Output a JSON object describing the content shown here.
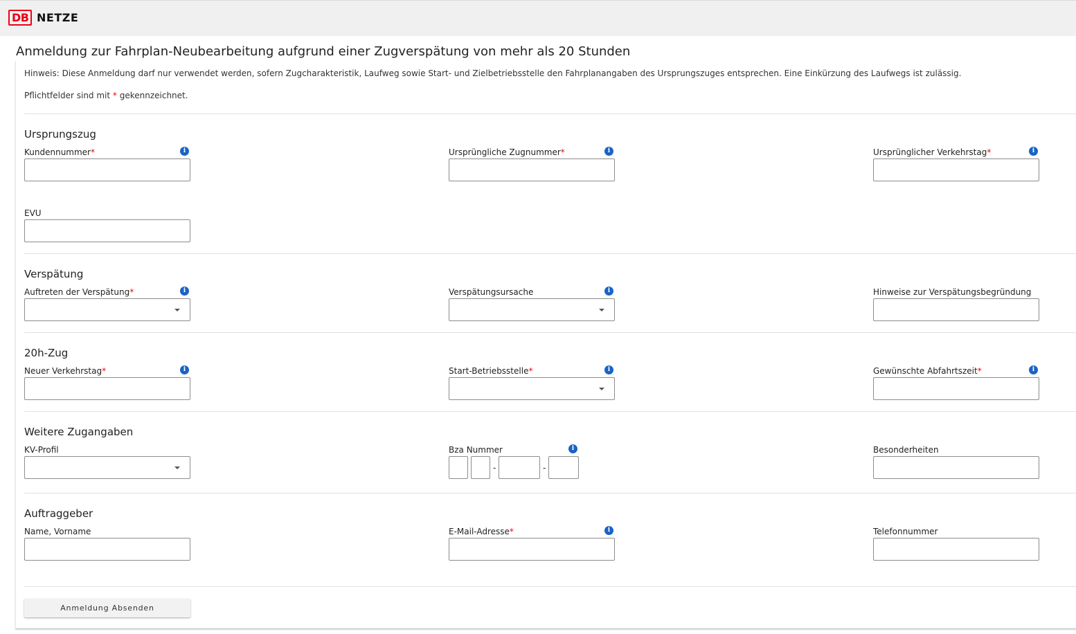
{
  "header": {
    "logo_text": "DB",
    "brand": "NETZE"
  },
  "page_title": "Anmeldung zur Fahrplan-Neubearbeitung aufgrund einer Zugverspätung von mehr als 20 Stunden",
  "hint": "Hinweis: Diese Anmeldung darf nur verwendet werden, sofern Zugcharakteristik, Laufweg sowie Start- und Zielbetriebsstelle den Fahrplanangaben des Ursprungszuges entsprechen. Eine Einkürzung des Laufwegs ist zulässig.",
  "required_note": {
    "before": "Pflichtfelder sind mit ",
    "star": "*",
    "after": " gekennzeichnet."
  },
  "sections": {
    "ursprungszug": {
      "title": "Ursprungszug",
      "kundennummer": "Kundennummer",
      "zugnummer": "Ursprüngliche Zugnummer",
      "verkehrstag": "Ursprünglicher Verkehrstag",
      "evu": "EVU"
    },
    "verspaetung": {
      "title": "Verspätung",
      "auftreten": "Auftreten der Verspätung",
      "ursache": "Verspätungsursache",
      "hinweise": "Hinweise zur Verspätungsbegründung"
    },
    "zug20h": {
      "title": "20h-Zug",
      "neuer_verkehrstag": "Neuer Verkehrstag",
      "start_betriebsstelle": "Start-Betriebsstelle",
      "abfahrtszeit": "Gewünschte Abfahrtszeit"
    },
    "weitere": {
      "title": "Weitere Zugangaben",
      "kv_profil": "KV-Profil",
      "bza_nummer": "Bza Nummer",
      "besonderheiten": "Besonderheiten",
      "dash": "-"
    },
    "auftraggeber": {
      "title": "Auftraggeber",
      "name": "Name, Vorname",
      "email": "E-Mail-Adresse",
      "telefon": "Telefonnummer"
    }
  },
  "required_star": "*",
  "info_glyph": "i",
  "submit_label": "Anmeldung Absenden",
  "colors": {
    "accent_red": "#ec0016",
    "info_blue": "#1a63c7"
  }
}
